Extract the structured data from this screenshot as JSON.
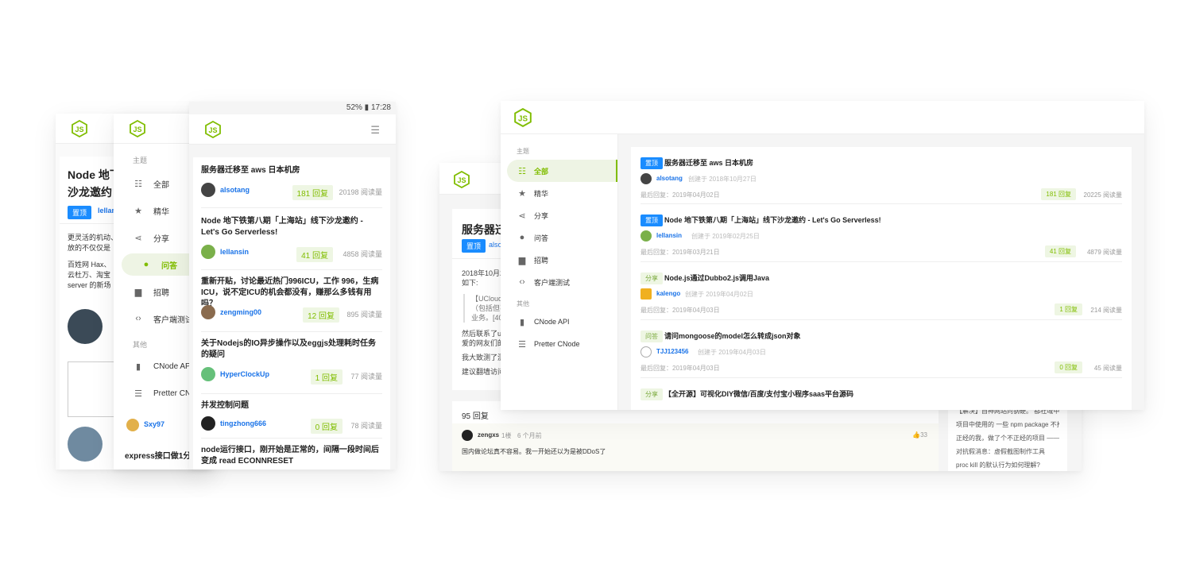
{
  "status_bar": {
    "text": "52% ▮ 17:28"
  },
  "colors": {
    "brand": "#80bd01",
    "blue": "#1a8cff",
    "pin_tag": "#1a8cff"
  },
  "screen1": {
    "title_line1": "Node 地下",
    "title_line2": "沙龙邀约",
    "pin_label": "置顶",
    "author": "lellan",
    "para1": "更灵活的机动、",
    "para1b": "放的不仅仅是",
    "para2a": "百姓网 Hax、",
    "para2b": "云杜万、淘宝",
    "para2c": "server 的新场",
    "user": "Sxy97",
    "bottom_title": "express接口做1分"
  },
  "screen2": {
    "section_label": "主题",
    "items": [
      {
        "label": "全部",
        "icon": "list-icon"
      },
      {
        "label": "精华",
        "icon": "star-icon"
      },
      {
        "label": "分享",
        "icon": "share-icon"
      },
      {
        "label": "问答",
        "icon": "question-icon"
      },
      {
        "label": "招聘",
        "icon": "briefcase-icon"
      },
      {
        "label": "客户端测试",
        "icon": "code-icon"
      }
    ],
    "other_label": "其他",
    "other_items": [
      {
        "label": "CNode API",
        "icon": "api-icon"
      },
      {
        "label": "Pretter CN",
        "icon": "list-icon"
      }
    ]
  },
  "screen3": {
    "topics": [
      {
        "title": "服务器迁移至 aws 日本机房",
        "author": "alsotang",
        "replies": "181 回复",
        "views": "20198 阅读量"
      },
      {
        "title": "Node 地下铁第八期「上海站」线下沙龙邀约 - Let's Go Serverless!",
        "author": "lellansin",
        "replies": "41 回复",
        "views": "4858 阅读量"
      },
      {
        "title": "重新开贴，讨论最近热门996ICU，工作 996，生病 ICU，说不定ICU的机会都没有，赚那么多钱有用吗？",
        "author": "zengming00",
        "replies": "12 回复",
        "views": "895 阅读量"
      },
      {
        "title": "关于Nodejs的IO异步操作以及eggjs处理耗时任务的疑问",
        "author": "HyperClockUp",
        "replies": "1 回复",
        "views": "77 阅读量"
      },
      {
        "title": "并发控制问题",
        "author": "tingzhong666",
        "replies": "0 回复",
        "views": "78 阅读量"
      },
      {
        "title": "node运行接口，刚开始是正常的，间隔一段时间后变成 read ECONNRESET",
        "author": "",
        "replies": "",
        "views": ""
      }
    ]
  },
  "desk_back": {
    "title": "服务器迁",
    "tag": "置顶",
    "author": "also",
    "date": "2018年10月27",
    "line2": "如下:",
    "quote1": "【UCloud】",
    "quote2": "（包括但不",
    "quote3": "业务。[400",
    "text1": "然后联系了uc",
    "text2": "爱的网友们的",
    "text3": "我大致测了测",
    "text4": "建议翻墙访问",
    "replies_header": "95 回复",
    "reply_user": "zengxs",
    "reply_floor": "1楼",
    "reply_time": "6 个月前",
    "reply_likes": "👍33",
    "reply_text": "国内做论坛真不容易。我一开始还以为是被DDoS了",
    "side_links": [
      "【解决】自神网站向钢硬。 都社域中域",
      "项目中使用的 一些 npm package 不推...",
      "正经的我，做了个不正经的项目 —— P...",
      "对抗假消息：虚假截图制作工具",
      "proc kill 的默认行为如何理解?"
    ]
  },
  "desk_front": {
    "section_label": "主题",
    "items": [
      {
        "label": "全部",
        "icon": "list-icon"
      },
      {
        "label": "精华",
        "icon": "star-icon"
      },
      {
        "label": "分享",
        "icon": "share-icon"
      },
      {
        "label": "问答",
        "icon": "question-icon"
      },
      {
        "label": "招聘",
        "icon": "briefcase-icon"
      },
      {
        "label": "客户端测试",
        "icon": "code-icon"
      }
    ],
    "other_label": "其他",
    "other_items": [
      {
        "label": "CNode API",
        "icon": "api-icon"
      },
      {
        "label": "Pretter CNode",
        "icon": "list-icon"
      }
    ],
    "topics": [
      {
        "tag": "置顶",
        "tag_type": "blue",
        "title": "服务器迁移至 aws 日本机房",
        "author": "alsotang",
        "created": "创建于 2018年10月27日",
        "last": "最后回复：2019年04月02日",
        "replies": "181 回复",
        "views": "20225 阅读量"
      },
      {
        "tag": "置顶",
        "tag_type": "blue",
        "title": "Node 地下铁第八期「上海站」线下沙龙邀约 - Let's Go Serverless!",
        "author": "lellansin",
        "created": "创建于 2019年02月25日",
        "last": "最后回复：2019年03月21日",
        "replies": "41 回复",
        "views": "4879 阅读量"
      },
      {
        "tag": "分享",
        "tag_type": "green",
        "title": "Node.js通过Dubbo2.js调用Java",
        "author": "kalengo",
        "created": "创建于 2019年04月02日",
        "last": "最后回复：2019年04月03日",
        "replies": "1 回复",
        "views": "214 阅读量"
      },
      {
        "tag": "问答",
        "tag_type": "green",
        "title": "请问mongoose的model怎么转成json对象",
        "author": "TJJ123456",
        "created": "创建于 2019年04月03日",
        "last": "最后回复：2019年04月03日",
        "replies": "0 回复",
        "views": "45 阅读量"
      },
      {
        "tag": "分享",
        "tag_type": "green",
        "title": "【全开源】可视化DIY微信/百度/支付宝小程序saas平台源码",
        "author": "",
        "created": "",
        "last": "",
        "replies": "",
        "views": ""
      }
    ]
  }
}
